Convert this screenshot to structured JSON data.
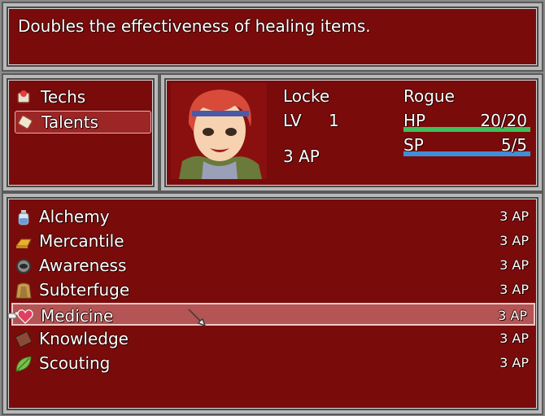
{
  "help": {
    "text": "Doubles the effectiveness of healing items."
  },
  "commands": [
    {
      "label": "Techs",
      "icon": "techs-book-icon"
    },
    {
      "label": "Talents",
      "icon": "talents-scroll-icon",
      "selected": true
    }
  ],
  "actor": {
    "name": "Locke",
    "class": "Rogue",
    "level_label": "LV",
    "level": "1",
    "ap": "3 AP",
    "hp_label": "HP",
    "hp": "20/20",
    "hp_fraction": 1.0,
    "sp_label": "SP",
    "sp": "5/5",
    "sp_fraction": 1.0
  },
  "talents": [
    {
      "name": "Alchemy",
      "cost": "3",
      "unit": "AP",
      "icon": "potion-bottle-icon"
    },
    {
      "name": "Mercantile",
      "cost": "3",
      "unit": "AP",
      "icon": "gold-bar-icon"
    },
    {
      "name": "Awareness",
      "cost": "3",
      "unit": "AP",
      "icon": "eye-ring-icon"
    },
    {
      "name": "Subterfuge",
      "cost": "3",
      "unit": "AP",
      "icon": "cloak-icon"
    },
    {
      "name": "Medicine",
      "cost": "3",
      "unit": "AP",
      "icon": "heart-icon",
      "selected": true
    },
    {
      "name": "Knowledge",
      "cost": "3",
      "unit": "AP",
      "icon": "book-icon"
    },
    {
      "name": "Scouting",
      "cost": "3",
      "unit": "AP",
      "icon": "leaf-icon"
    }
  ],
  "colors": {
    "window": "#7a0b0b",
    "hp_gauge": "#3fbf5a",
    "sp_gauge": "#3f8fd8"
  }
}
